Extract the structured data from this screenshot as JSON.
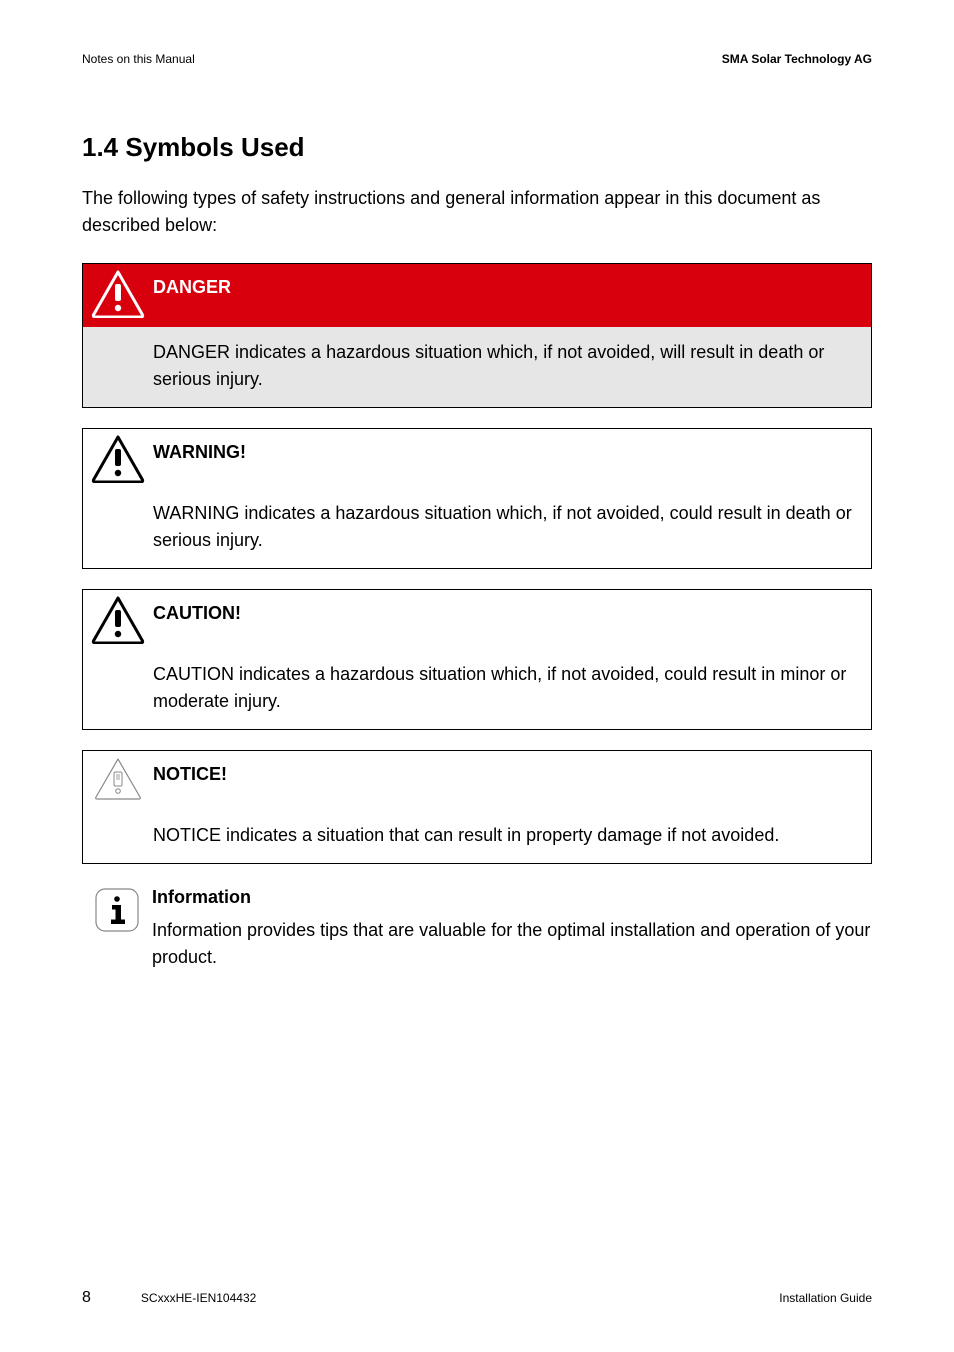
{
  "header": {
    "left": "Notes on this Manual",
    "right": "SMA Solar Technology AG"
  },
  "heading": "1.4 Symbols Used",
  "intro": "The following types of safety instructions and general information appear in this document as described below:",
  "boxes": {
    "danger": {
      "title": "DANGER",
      "body": "DANGER indicates a hazardous situation which, if not avoided, will result in death or serious injury."
    },
    "warning": {
      "title": "WARNING!",
      "body": "WARNING indicates a hazardous situation which, if not avoided, could result in death or serious injury."
    },
    "caution": {
      "title": "CAUTION!",
      "body": "CAUTION indicates a hazardous situation which, if not avoided, could result in minor or moderate injury."
    },
    "notice": {
      "title": "NOTICE!",
      "body": "NOTICE indicates a situation that can result in property damage if not avoided."
    }
  },
  "info": {
    "title": "Information",
    "body": "Information provides tips that are valuable for the optimal installation and operation of your product."
  },
  "footer": {
    "page": "8",
    "docid": "SCxxxHE-IEN104432",
    "right": "Installation Guide"
  }
}
